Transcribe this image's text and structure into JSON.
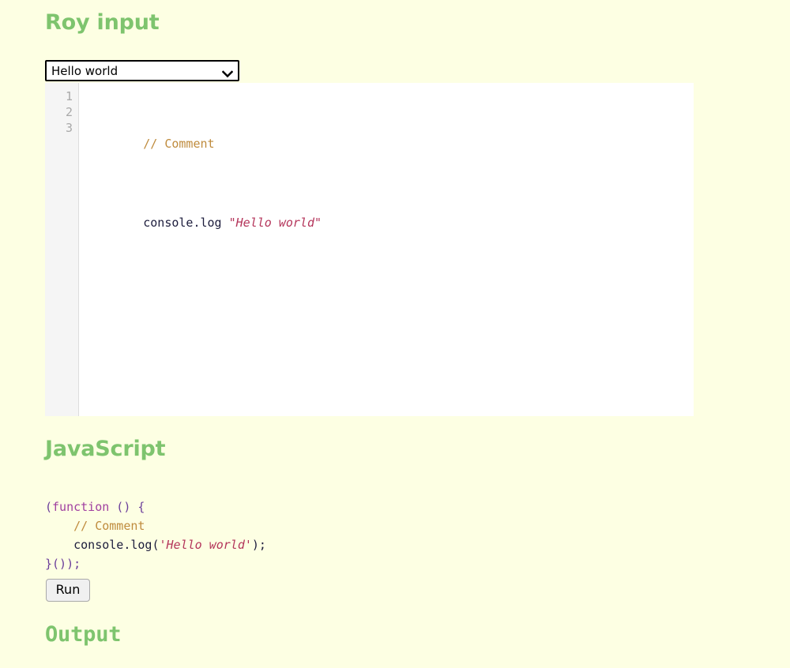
{
  "page": {
    "background_color": "#fdffe3",
    "heading_color": "#7ec46e"
  },
  "input_section": {
    "heading": "Roy input",
    "sample_select": {
      "name": "sample-select",
      "selected_value": "Hello world",
      "options": [
        "Hello world"
      ],
      "chevron_icon": "chevron-down-icon"
    },
    "editor": {
      "line_numbers": [
        "1",
        "2",
        "3"
      ],
      "lines": [
        {
          "number": "1",
          "tokens": [
            {
              "text": "// Comment",
              "kind": "comment"
            }
          ]
        },
        {
          "number": "2",
          "tokens": [
            {
              "text": "console.log ",
              "kind": "plain"
            },
            {
              "text": "\"Hello world\"",
              "kind": "string"
            }
          ]
        },
        {
          "number": "3",
          "tokens": []
        }
      ]
    }
  },
  "javascript_section": {
    "heading": "JavaScript",
    "lines": [
      {
        "tokens": [
          {
            "text": "(",
            "kind": "punct"
          },
          {
            "text": "function",
            "kind": "keyword"
          },
          {
            "text": " () {",
            "kind": "punct"
          }
        ]
      },
      {
        "tokens": [
          {
            "text": "    ",
            "kind": "plain"
          },
          {
            "text": "// Comment",
            "kind": "comment"
          }
        ]
      },
      {
        "tokens": [
          {
            "text": "    console.log(",
            "kind": "plain"
          },
          {
            "text": "'Hello world'",
            "kind": "string"
          },
          {
            "text": ");",
            "kind": "plain"
          }
        ]
      },
      {
        "tokens": [
          {
            "text": "}());",
            "kind": "punct"
          }
        ]
      }
    ]
  },
  "run_button": {
    "label": "Run"
  },
  "output_section": {
    "heading": "Output",
    "content": ""
  },
  "token_colors": {
    "comment": "#bf8b3d",
    "string": "#b4345a",
    "plain": "#1c1c3c",
    "keyword": "#a03fa0",
    "punct": "#6a3d9a"
  }
}
